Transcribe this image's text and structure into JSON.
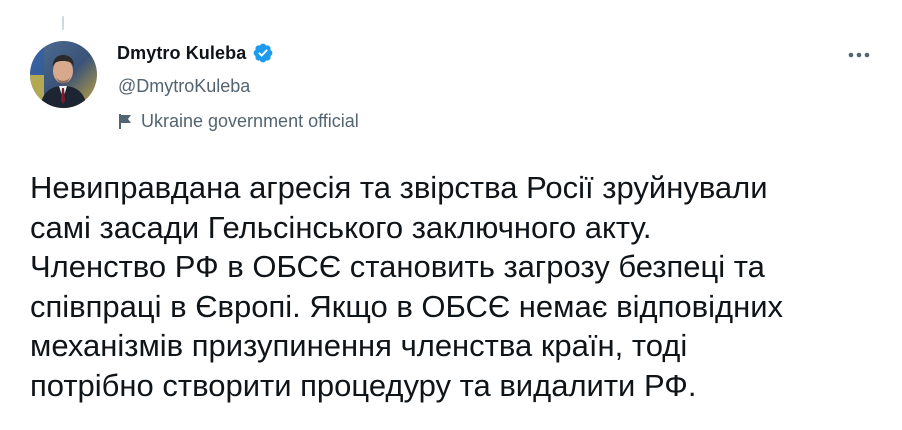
{
  "author": {
    "display_name": "Dmytro Kuleba",
    "handle": "@DmytroKuleba",
    "verified_icon": "verified-badge-icon",
    "label": "Ukraine government official",
    "label_icon": "flag-icon"
  },
  "more_icon": "more-options-icon",
  "tweet": {
    "lines": [
      "Невиправдана агресія та звірства Росії зруйнували",
      "самі засади Гельсінського заключного акту.",
      "Членство РФ в ОБСЄ становить загрозу безпеці та",
      "співпраці в Європі. Якщо в ОБСЄ немає відповідних",
      "механізмів призупинення членства країн, тоді",
      "потрібно створити процедуру та видалити РФ."
    ]
  },
  "colors": {
    "text": "#0f1419",
    "secondary": "#536471",
    "verified": "#1d9bf0",
    "thread_line": "#cfd9de"
  }
}
